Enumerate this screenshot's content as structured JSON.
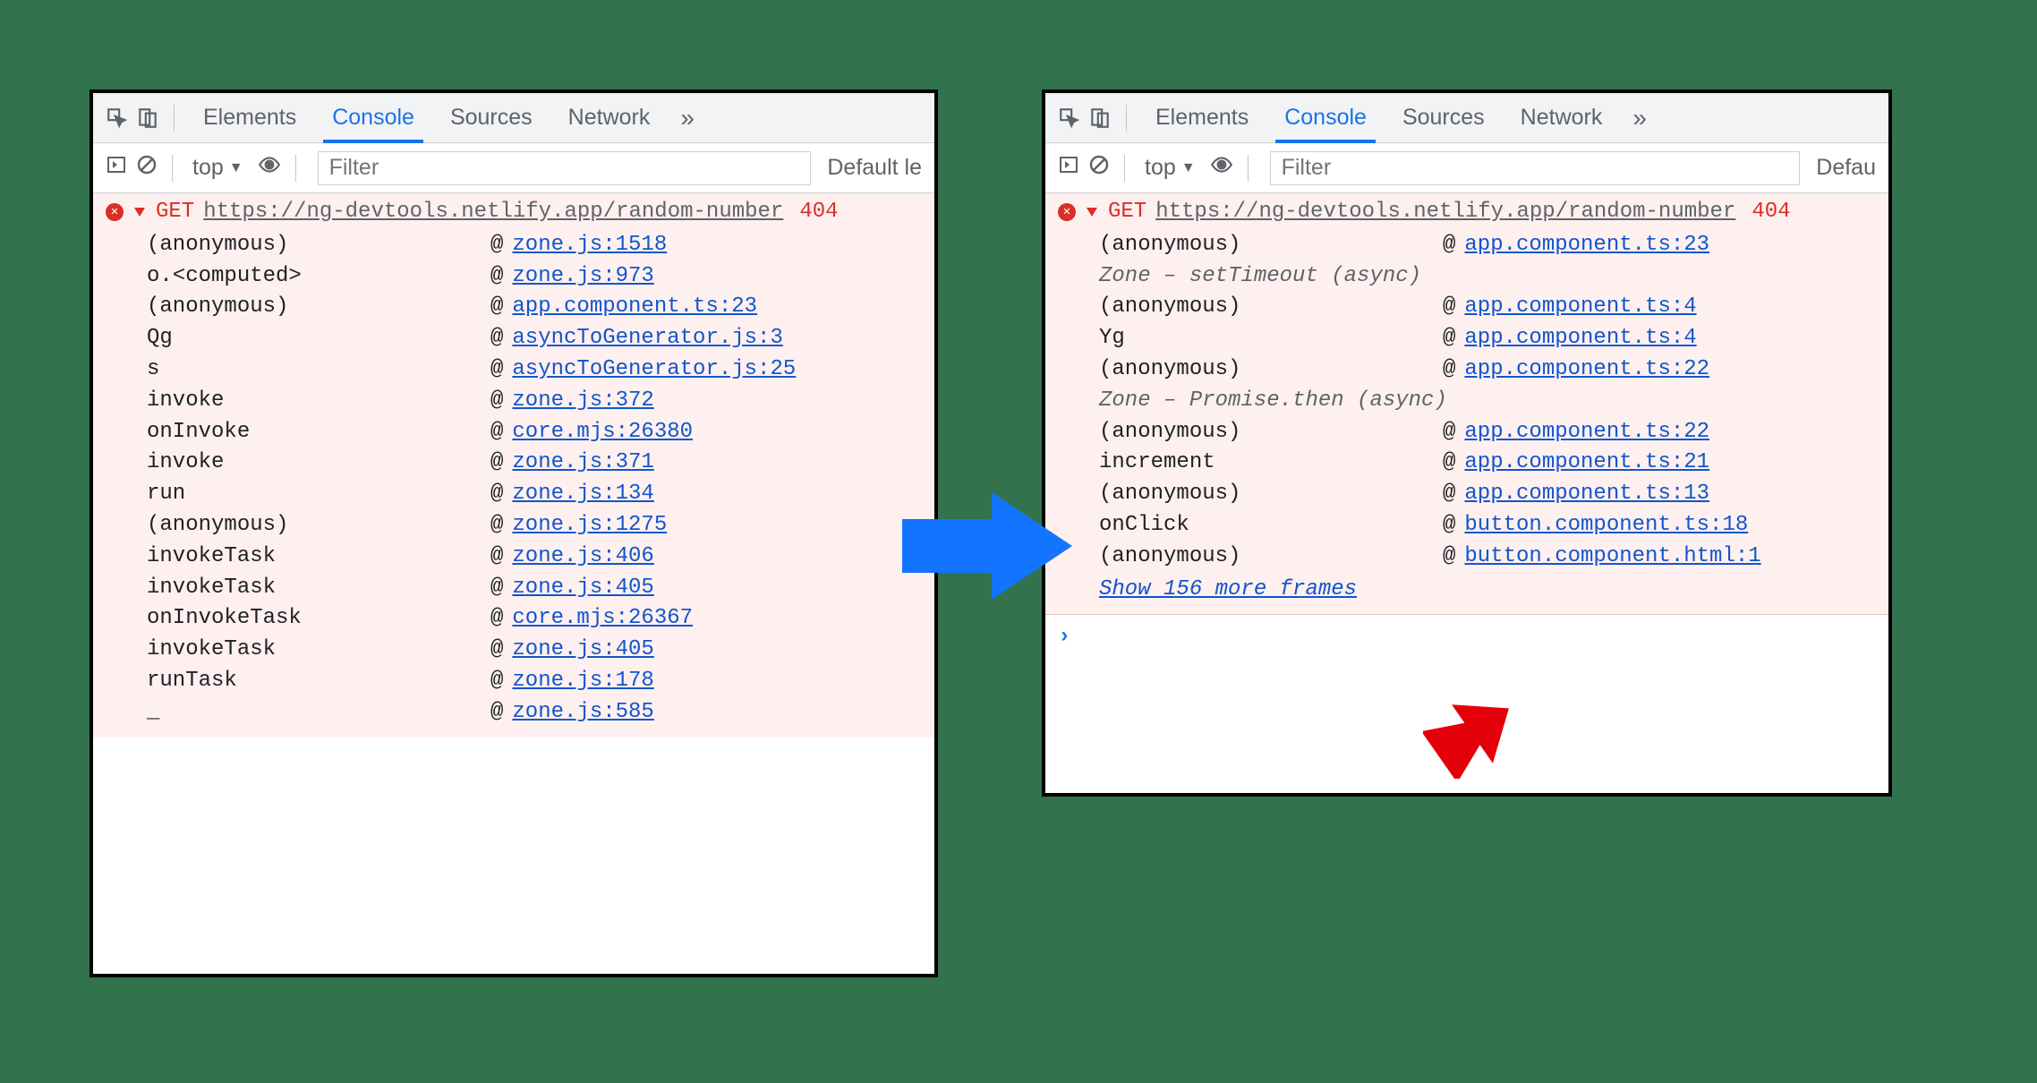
{
  "tabs": {
    "elements": "Elements",
    "console": "Console",
    "sources": "Sources",
    "network": "Network"
  },
  "toolbar": {
    "context": "top",
    "filter_placeholder": "Filter",
    "level_left": "Default le",
    "level_right": "Defau"
  },
  "error": {
    "method": "GET",
    "url": "https://ng-devtools.netlify.app/random-number",
    "status": "404"
  },
  "left_stack": [
    {
      "fn": "(anonymous)",
      "src": "zone.js:1518"
    },
    {
      "fn": "o.<computed>",
      "src": "zone.js:973"
    },
    {
      "fn": "(anonymous)",
      "src": "app.component.ts:23"
    },
    {
      "fn": "Qg",
      "src": "asyncToGenerator.js:3"
    },
    {
      "fn": "s",
      "src": "asyncToGenerator.js:25"
    },
    {
      "fn": "invoke",
      "src": "zone.js:372"
    },
    {
      "fn": "onInvoke",
      "src": "core.mjs:26380"
    },
    {
      "fn": "invoke",
      "src": "zone.js:371"
    },
    {
      "fn": "run",
      "src": "zone.js:134"
    },
    {
      "fn": "(anonymous)",
      "src": "zone.js:1275"
    },
    {
      "fn": "invokeTask",
      "src": "zone.js:406"
    },
    {
      "fn": "invokeTask",
      "src": "zone.js:405"
    },
    {
      "fn": "onInvokeTask",
      "src": "core.mjs:26367"
    },
    {
      "fn": "invokeTask",
      "src": "zone.js:405"
    },
    {
      "fn": "runTask",
      "src": "zone.js:178"
    },
    {
      "fn": "_",
      "src": "zone.js:585"
    }
  ],
  "right_stack": [
    {
      "fn": "(anonymous)",
      "src": "app.component.ts:23"
    },
    {
      "fn": "Zone – setTimeout (async)",
      "section": true
    },
    {
      "fn": "(anonymous)",
      "src": "app.component.ts:4"
    },
    {
      "fn": "Yg",
      "src": "app.component.ts:4"
    },
    {
      "fn": "(anonymous)",
      "src": "app.component.ts:22"
    },
    {
      "fn": "Zone – Promise.then (async)",
      "section": true
    },
    {
      "fn": "(anonymous)",
      "src": "app.component.ts:22"
    },
    {
      "fn": "increment",
      "src": "app.component.ts:21"
    },
    {
      "fn": "(anonymous)",
      "src": "app.component.ts:13"
    },
    {
      "fn": "onClick",
      "src": "button.component.ts:18"
    },
    {
      "fn": "(anonymous)",
      "src": "button.component.html:1"
    }
  ],
  "show_more": "Show 156 more frames"
}
